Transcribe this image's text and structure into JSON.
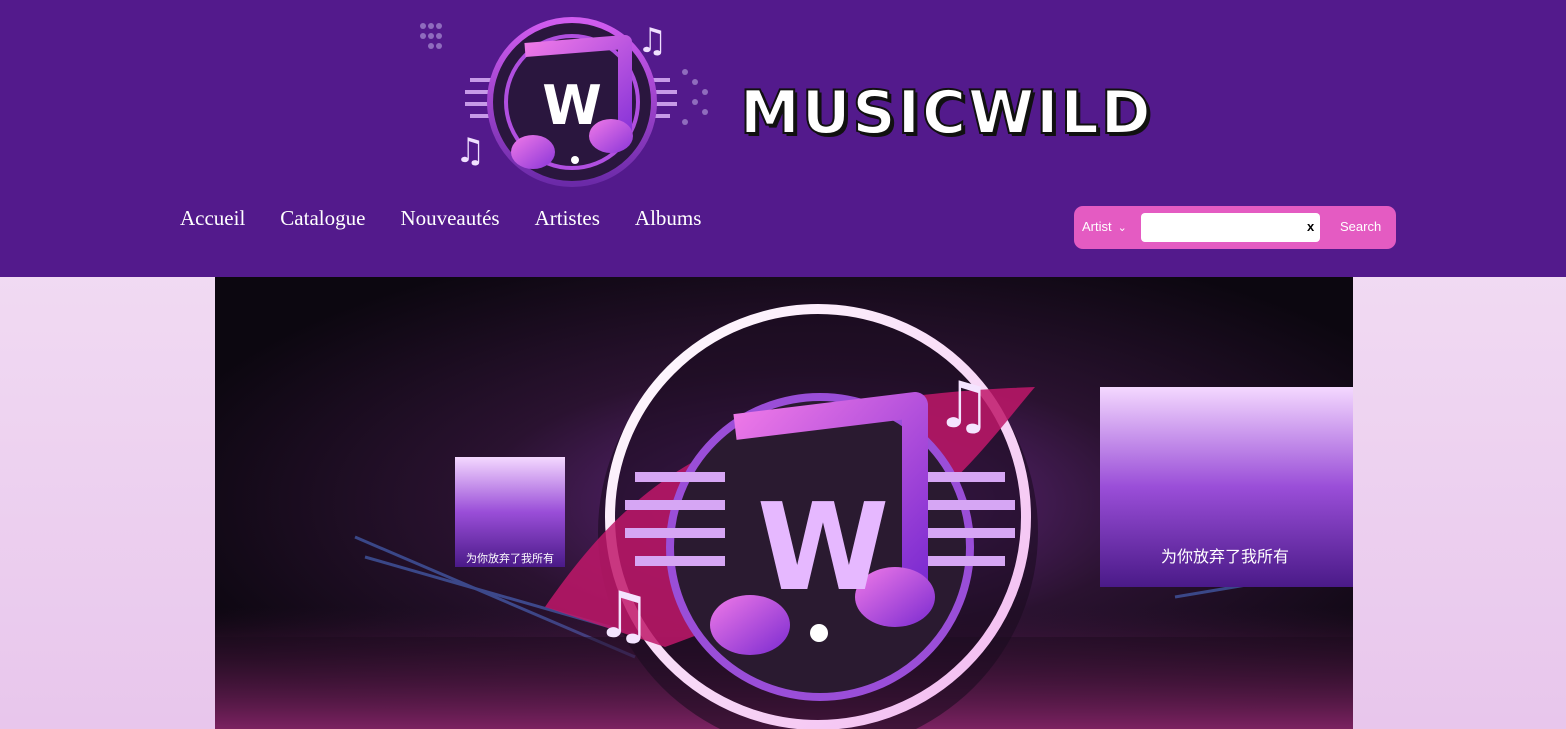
{
  "brand": {
    "name": "MUSICWILD",
    "logo_icon": "music-note-w-logo-icon"
  },
  "nav": {
    "items": [
      {
        "label": "Accueil"
      },
      {
        "label": "Catalogue"
      },
      {
        "label": "Nouveautés"
      },
      {
        "label": "Artistes"
      },
      {
        "label": "Albums"
      }
    ]
  },
  "search": {
    "filter_selected": "Artist",
    "input_value": "",
    "clear_label": "x",
    "button_label": "Search"
  },
  "hero": {
    "screen_caption_left": "为你放弃了我所有",
    "screen_caption_right": "为你放弃了我所有"
  },
  "colors": {
    "header_bg": "#531a8c",
    "search_bg": "#e45bc2",
    "accent_magenta": "#e040c0",
    "accent_purple": "#8a3fd8"
  }
}
